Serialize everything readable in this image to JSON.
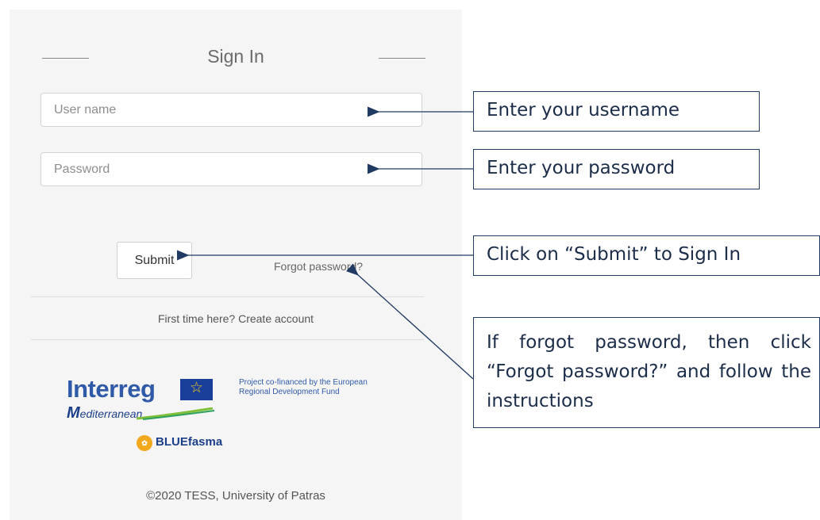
{
  "signin": {
    "title": "Sign In",
    "username_placeholder": "User name",
    "password_placeholder": "Password",
    "submit_label": "Submit",
    "forgot_label": "Forgot password?",
    "first_time_text": "First time here? Create account"
  },
  "logos": {
    "interreg": "Interreg",
    "mediterranean": "editerranean",
    "mediterranean_initial": "M",
    "bluefasma": "BLUEfasma",
    "cofinanced": "Project co-financed by the European Regional Development Fund"
  },
  "footer": {
    "copyright": "©2020 TESS, University of Patras"
  },
  "callouts": {
    "username": "Enter your username",
    "password": "Enter your password",
    "submit": "Click on “Submit” to Sign In",
    "forgot": "If forgot password, then click “Forgot password?” and follow the instructions"
  },
  "colors": {
    "panel_background": "#f5f5f5",
    "callout_border": "#1f3a63",
    "interreg_blue": "#2f5aa8",
    "eu_flag_blue": "#1a3f9a",
    "eu_star_yellow": "#f6cf1b",
    "bluefasma_orange": "#f2a91e"
  }
}
